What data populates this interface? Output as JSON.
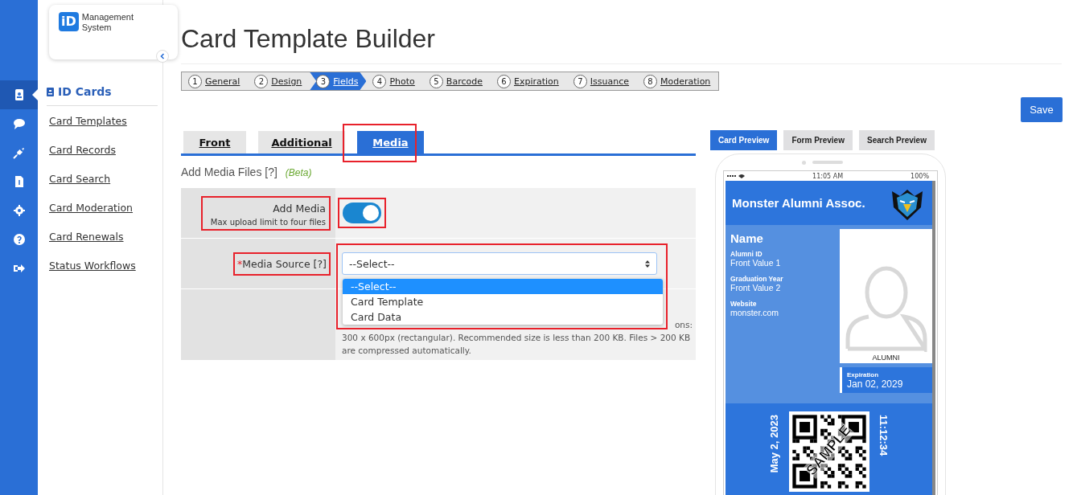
{
  "brand": {
    "logo": "iD",
    "name": "Management System"
  },
  "rail": [
    {
      "selected": true
    },
    {
      "selected": false
    },
    {
      "selected": false
    },
    {
      "selected": false
    },
    {
      "selected": false
    },
    {
      "selected": false
    },
    {
      "selected": false
    }
  ],
  "sidebar": {
    "heading": "ID Cards",
    "items": [
      "Card Templates",
      "Card Records",
      "Card Search",
      "Card Moderation",
      "Card Renewals",
      "Status Workflows"
    ]
  },
  "page_title": "Card Template Builder",
  "steps": [
    {
      "number": "1",
      "label": "General",
      "selected": false
    },
    {
      "number": "2",
      "label": "Design",
      "selected": false
    },
    {
      "number": "3",
      "label": "Fields",
      "selected": true
    },
    {
      "number": "4",
      "label": "Photo",
      "selected": false
    },
    {
      "number": "5",
      "label": "Barcode",
      "selected": false
    },
    {
      "number": "6",
      "label": "Expiration",
      "selected": false
    },
    {
      "number": "7",
      "label": "Issuance",
      "selected": false
    },
    {
      "number": "8",
      "label": "Moderation",
      "selected": false
    }
  ],
  "save_button": "Save",
  "tabs": [
    {
      "label": "Front",
      "selected": false
    },
    {
      "label": "Additional",
      "selected": false
    },
    {
      "label": "Media",
      "selected": true
    }
  ],
  "section": {
    "title": "Add Media Files",
    "help": "[?]",
    "note": "(Beta)"
  },
  "add_media": {
    "label": "Add Media",
    "hint": "Max upload limit to four files",
    "on": true
  },
  "media_source": {
    "label": "Media Source",
    "required": true,
    "required_mark": "*",
    "help": "[?]",
    "value": "--Select--",
    "options": [
      {
        "label": "--Select--",
        "selected": true
      },
      {
        "label": "Card Template",
        "selected": false
      },
      {
        "label": "Card Data",
        "selected": false
      }
    ]
  },
  "help_text": {
    "line_end": "ons:",
    "lines": [
      "300 x 600px (rectangular). Recommended size is less than 200 KB. Files > 200 KB",
      "are compressed automatically."
    ]
  },
  "preview_tabs": [
    {
      "label": "Card Preview",
      "selected": true
    },
    {
      "label": "Form Preview",
      "selected": false
    },
    {
      "label": "Search Preview",
      "selected": false
    }
  ],
  "phone": {
    "time": "11:05 AM",
    "battery": "100%"
  },
  "card": {
    "title": "Monster Alumni Assoc.",
    "name": "Name",
    "fields": [
      {
        "label": "Alumni ID",
        "value": "Front Value 1"
      },
      {
        "label": "Graduation Year",
        "value": "Front Value 2"
      },
      {
        "label": "Website",
        "value": "monster.com"
      }
    ],
    "photo_label": "ALUMNI",
    "expiration": {
      "label": "Expiration",
      "value": "Jan 02, 2029"
    },
    "date": "May 2, 2023",
    "time": "11:12:34",
    "stamp": "SAMPLE"
  }
}
